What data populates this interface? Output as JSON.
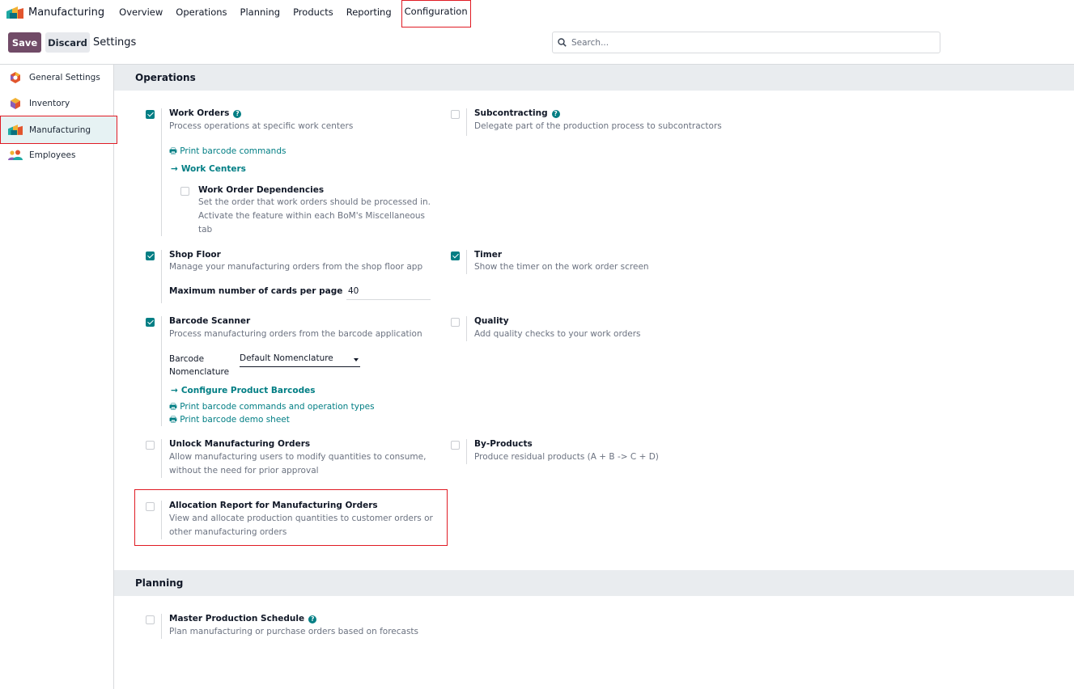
{
  "app": {
    "title": "Manufacturing",
    "menu": [
      "Overview",
      "Operations",
      "Planning",
      "Products",
      "Reporting",
      "Configuration"
    ]
  },
  "control": {
    "save": "Save",
    "discard": "Discard",
    "title": "Settings",
    "search_placeholder": "Search..."
  },
  "sidebar": {
    "items": [
      "General Settings",
      "Inventory",
      "Manufacturing",
      "Employees"
    ]
  },
  "sections": {
    "operations": "Operations",
    "planning": "Planning"
  },
  "settings": {
    "work_orders": {
      "title": "Work Orders",
      "desc": "Process operations at specific work centers",
      "link_print": "Print barcode commands",
      "link_centers": "Work Centers",
      "checked": true
    },
    "work_order_dependencies": {
      "title": "Work Order Dependencies",
      "desc1": "Set the order that work orders should be processed in.",
      "desc2": "Activate the feature within each BoM's Miscellaneous",
      "desc3": "tab",
      "checked": false
    },
    "subcontracting": {
      "title": "Subcontracting",
      "desc": "Delegate part of the production process to subcontractors",
      "checked": false
    },
    "shop_floor": {
      "title": "Shop Floor",
      "desc": "Manage your manufacturing orders from the shop floor app",
      "field_label": "Maximum number of cards per page",
      "field_value": "40",
      "checked": true
    },
    "timer": {
      "title": "Timer",
      "desc": "Show the timer on the work order screen",
      "checked": true
    },
    "barcode_scanner": {
      "title": "Barcode Scanner",
      "desc": "Process manufacturing orders from the barcode application",
      "nomenclature_label1": "Barcode",
      "nomenclature_label2": "Nomenclature",
      "nomenclature_value": "Default Nomenclature",
      "link_configure": "Configure Product Barcodes",
      "link_print_ops": "Print barcode commands and operation types",
      "link_demo": "Print barcode demo sheet",
      "checked": true
    },
    "quality": {
      "title": "Quality",
      "desc": "Add quality checks to your work orders",
      "checked": false
    },
    "unlock": {
      "title": "Unlock Manufacturing Orders",
      "desc1": "Allow manufacturing users to modify quantities to consume,",
      "desc2": "without the need for prior approval",
      "checked": false
    },
    "byproducts": {
      "title": "By-Products",
      "desc": "Produce residual products (A + B -> C + D)",
      "checked": false
    },
    "allocation": {
      "title": "Allocation Report for Manufacturing Orders",
      "desc1": "View and allocate production quantities to customer orders or",
      "desc2": "other manufacturing orders",
      "checked": false
    },
    "mps": {
      "title": "Master Production Schedule",
      "desc": "Plan manufacturing or purchase orders based on forecasts",
      "checked": false
    }
  },
  "colors": {
    "primary": "#714b67",
    "accent": "#017e84",
    "highlight": "#e01b24"
  }
}
